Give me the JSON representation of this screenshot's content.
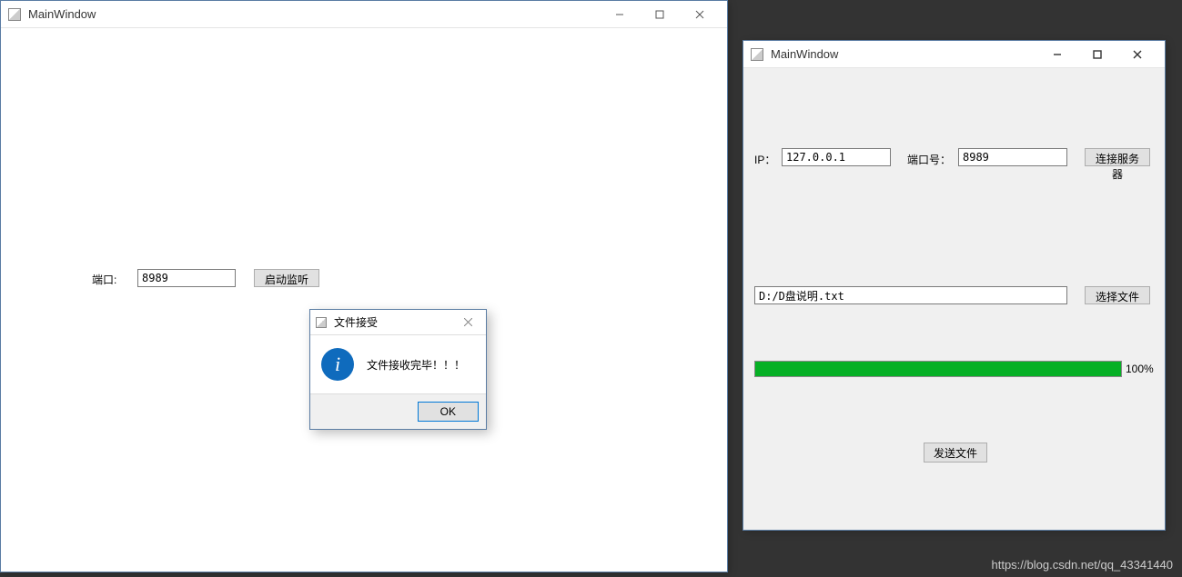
{
  "server": {
    "title": "MainWindow",
    "port_label": "端口:",
    "port_value": "8989",
    "listen_button": "启动监听"
  },
  "dialog": {
    "title": "文件接受",
    "message": "文件接收完毕！！！",
    "ok_button": "OK"
  },
  "client": {
    "title": "MainWindow",
    "ip_label": "IP：",
    "ip_value": "127.0.0.1",
    "port_label": "端口号：",
    "port_value": "8989",
    "connect_button": "连接服务器",
    "file_path": "D:/D盘说明.txt",
    "choose_file_button": "选择文件",
    "progress_percent": 100,
    "progress_text": "100%",
    "send_button": "发送文件"
  },
  "watermark": "https://blog.csdn.net/qq_43341440"
}
